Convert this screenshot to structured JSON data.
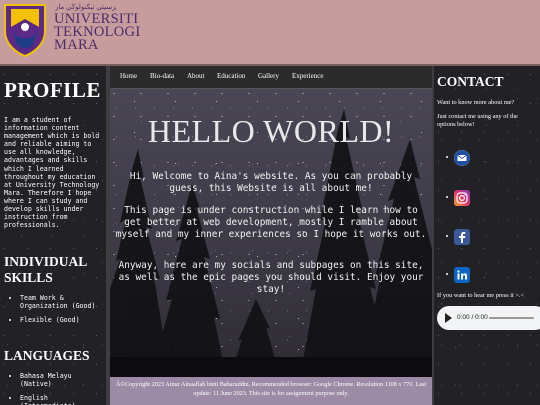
{
  "header": {
    "logo_line1": "UNIVERSITI",
    "logo_line2": "TEKNOLOGI",
    "logo_line3": "MARA",
    "logo_script": "ﻮﻨﻴۏﺮسيتي تيكنولوڬي مار"
  },
  "sidebar": {
    "profile_title": "PROFILE",
    "profile_text": "I am a student of information content management which is bold and reliable aiming to use all knowledge, advantages and skills which I learned throughout my education at University Technology Mara. Therefore I hope where I can study and develop skills under instruction from professionals.",
    "skills_title": "INDIVIDUAL SKILLS",
    "skills": [
      "Team Work & Organization (Good)",
      "Flexible (Good)"
    ],
    "languages_title": "LANGUAGES",
    "languages": [
      "Bahasa Melayu (Native)",
      "English (Intermediate)"
    ]
  },
  "nav": {
    "items": [
      "Home",
      "Bio-data",
      "About",
      "Education",
      "Gallery",
      "Experience"
    ]
  },
  "hero": {
    "title": "HELLO WORLD!",
    "p1": "Hi, Welcome to Aina's website. As you can probably guess, this Website is all about me!",
    "p2": "This page is under construction while I learn how to get better at web development, mostly I ramble about myself and my inner experiences so I hope it works out.",
    "p3": "Anyway, here are my socials and subpages on this site, as well as the epic pages you should visit. Enjoy your stay!"
  },
  "footer": {
    "text": "Â©Copyright 2023 Ainur Ainaaflah binti Baharuddin. Recommended browser: Google Chrome. Resolution 1108 x 770. Last update: 11 June 2023. This site is for assignment purpose only."
  },
  "contact": {
    "title": "CONTACT",
    "p1": "Want to know more about me?",
    "p2": "Just contact me using any of the options below!",
    "socials": [
      "email-icon",
      "instagram-icon",
      "facebook-icon",
      "linkedin-icon"
    ],
    "hear_me": "If you want to hear me press it >.<",
    "audio_time": "0:00 / 0:00"
  },
  "colors": {
    "header_bg": "#c79c9d",
    "logo_text": "#4b2d6b",
    "footer_bg": "#9b8ba6",
    "page_bg": "#1c1c1e"
  }
}
